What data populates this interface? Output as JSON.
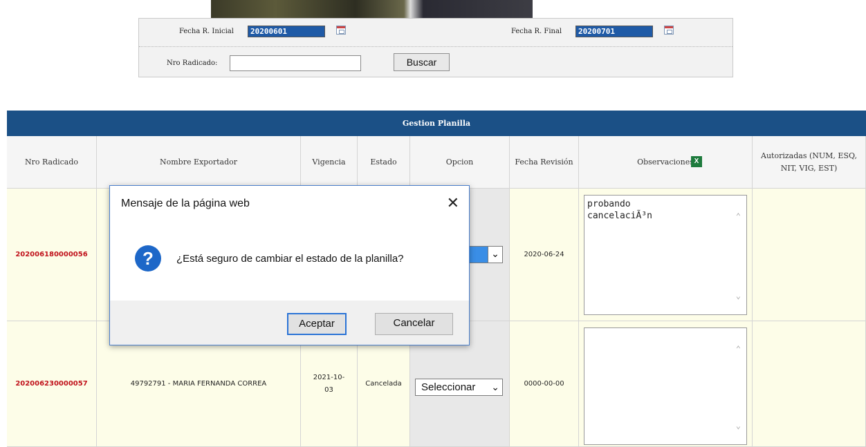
{
  "search_form": {
    "fecha_inicial_label": "Fecha R. Inicial",
    "fecha_inicial_value": "20200601",
    "fecha_final_label": "Fecha R. Final",
    "fecha_final_value": "20200701",
    "nro_radicado_label": "Nro Radicado:",
    "nro_radicado_value": "",
    "buscar_label": "Buscar"
  },
  "table": {
    "title": "Gestion Planilla",
    "headers": {
      "nro_radicado": "Nro Radicado",
      "nombre_exportador": "Nombre Exportador",
      "vigencia": "Vigencia",
      "estado": "Estado",
      "opcion": "Opcion",
      "fecha_revision": "Fecha Revisión",
      "observaciones": "Observaciones",
      "autorizadas": "Autorizadas (NUM, ESQ, NIT, VIG, EST)"
    },
    "rows": [
      {
        "nro_radicado": "202006180000056",
        "nombre_exportador": "",
        "vigencia": "",
        "estado": "",
        "opcion": "",
        "fecha_revision": "2020-06-24",
        "observaciones": "probando cancelaciÃ³n",
        "autorizadas": ""
      },
      {
        "nro_radicado": "202006230000057",
        "nombre_exportador": "49792791 - MARIA FERNANDA CORREA",
        "vigencia": "2021-10-03",
        "estado": "Cancelada",
        "opcion": "Seleccionar",
        "fecha_revision": "0000-00-00",
        "observaciones": "",
        "autorizadas": ""
      }
    ]
  },
  "dialog": {
    "title": "Mensaje de la página web",
    "message": "¿Está seguro de cambiar el estado de la planilla?",
    "ok_label": "Aceptar",
    "cancel_label": "Cancelar",
    "close_glyph": "✕",
    "question_glyph": "?"
  },
  "icons": {
    "excel": "excel-export-icon",
    "calendar": "calendar-icon",
    "question": "question-icon"
  }
}
